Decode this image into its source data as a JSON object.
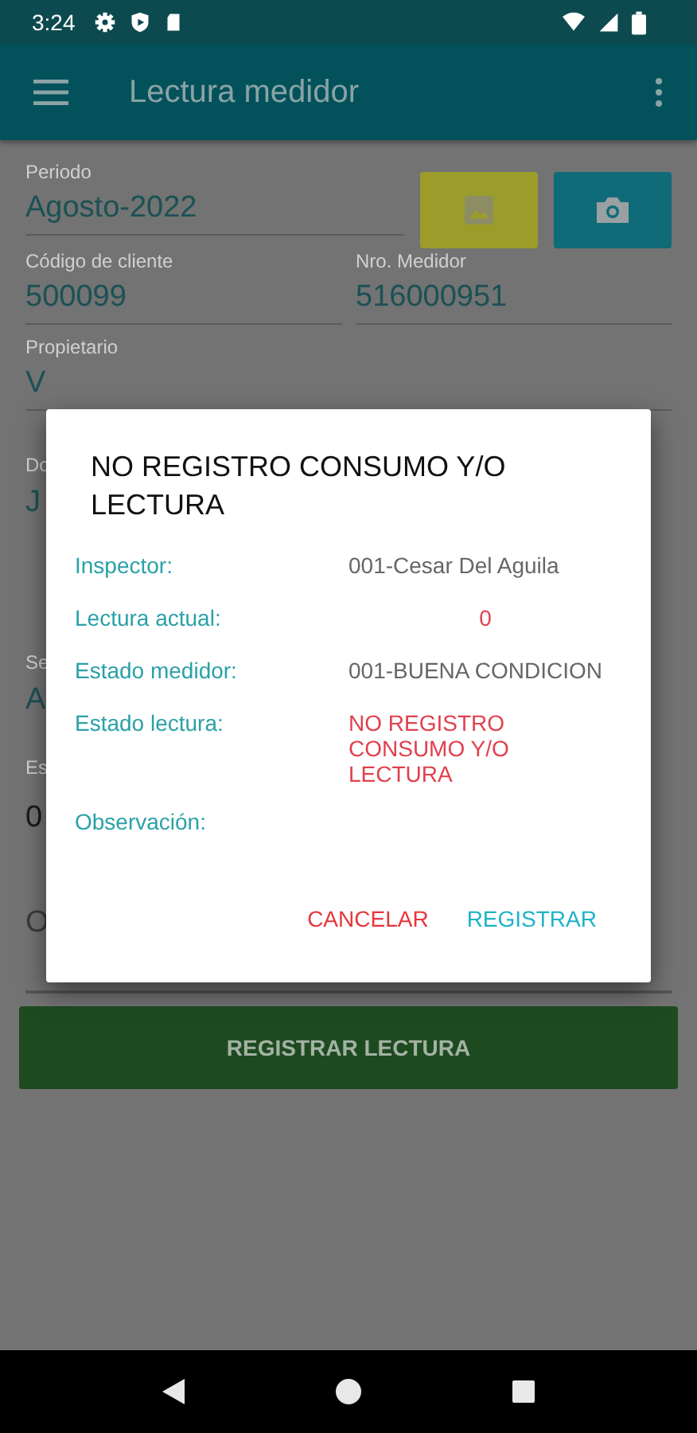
{
  "status_bar": {
    "time": "3:24"
  },
  "app_bar": {
    "title": "Lectura medidor"
  },
  "form": {
    "periodo": {
      "label": "Periodo",
      "value": "Agosto-2022"
    },
    "codigo": {
      "label": "Código de cliente",
      "value": "500099"
    },
    "medidor": {
      "label": "Nro. Medidor",
      "value": "516000951"
    },
    "propietario": {
      "label": "Propietario",
      "value": "V"
    },
    "partial_fields": [
      {
        "label": "Do",
        "value": "J"
      },
      {
        "label": "Se",
        "value": "A"
      },
      {
        "label": "Es",
        "value": "0"
      },
      {
        "value": "O"
      }
    ]
  },
  "dialog": {
    "title": "NO REGISTRO CONSUMO Y/O LECTURA",
    "rows": [
      {
        "label": "Inspector:",
        "value": "001-Cesar Del Aguila",
        "kind": "plain"
      },
      {
        "label": "Lectura actual:",
        "value": "0",
        "kind": "count"
      },
      {
        "label": "Estado medidor:",
        "value": "001-BUENA CONDICION",
        "kind": "plain"
      },
      {
        "label": "Estado lectura:",
        "value": "NO REGISTRO CONSUMO Y/O LECTURA",
        "kind": "alert"
      },
      {
        "label": "Observación:"
      }
    ],
    "cancel": "CANCELAR",
    "confirm": "REGISTRAR"
  },
  "register_button": "REGISTRAR LECTURA"
}
